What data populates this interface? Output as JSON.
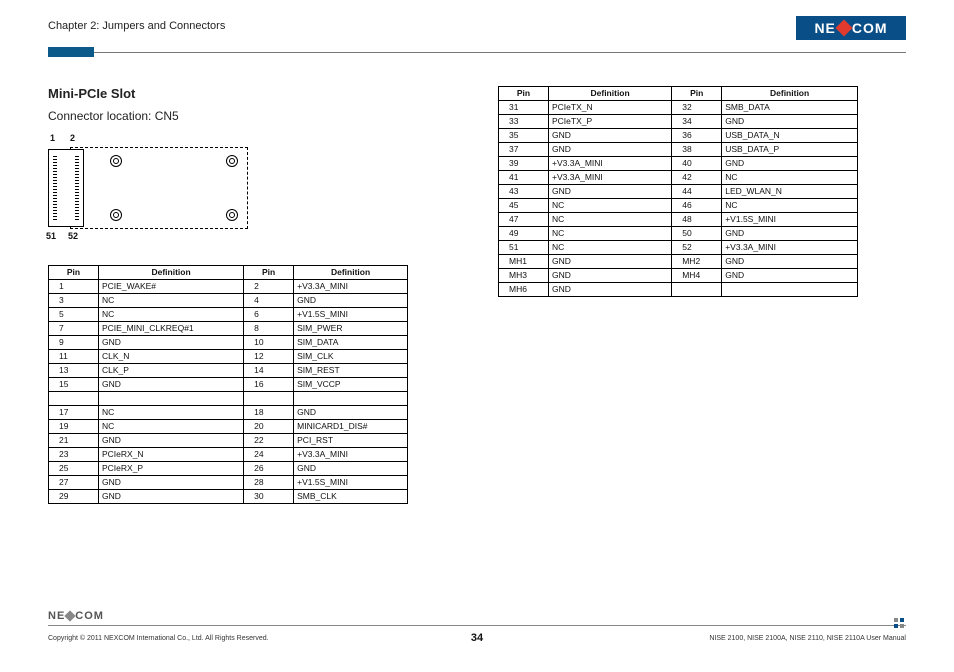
{
  "header": {
    "chapter": "Chapter 2: Jumpers and Connectors",
    "logo_pre": "NE",
    "logo_post": "COM"
  },
  "section": {
    "title": "Mini-PCIe Slot",
    "location": "Connector location: CN5",
    "diagram_labels": {
      "p1": "1",
      "p2": "2",
      "p51": "51",
      "p52": "52"
    }
  },
  "table_headers": {
    "pin": "Pin",
    "def": "Definition"
  },
  "left_rows_a": [
    {
      "p1": "1",
      "d1": "PCIE_WAKE#",
      "p2": "2",
      "d2": "+V3.3A_MINI"
    },
    {
      "p1": "3",
      "d1": "NC",
      "p2": "4",
      "d2": "GND"
    },
    {
      "p1": "5",
      "d1": "NC",
      "p2": "6",
      "d2": "+V1.5S_MINI"
    },
    {
      "p1": "7",
      "d1": "PCIE_MINI_CLKREQ#1",
      "p2": "8",
      "d2": "SIM_PWER"
    },
    {
      "p1": "9",
      "d1": "GND",
      "p2": "10",
      "d2": "SIM_DATA"
    },
    {
      "p1": "11",
      "d1": "CLK_N",
      "p2": "12",
      "d2": "SIM_CLK"
    },
    {
      "p1": "13",
      "d1": "CLK_P",
      "p2": "14",
      "d2": "SIM_REST"
    },
    {
      "p1": "15",
      "d1": "GND",
      "p2": "16",
      "d2": "SIM_VCCP"
    }
  ],
  "left_rows_b": [
    {
      "p1": "17",
      "d1": "NC",
      "p2": "18",
      "d2": "GND"
    },
    {
      "p1": "19",
      "d1": "NC",
      "p2": "20",
      "d2": "MINICARD1_DIS#"
    },
    {
      "p1": "21",
      "d1": "GND",
      "p2": "22",
      "d2": "PCI_RST"
    },
    {
      "p1": "23",
      "d1": "PCIeRX_N",
      "p2": "24",
      "d2": "+V3.3A_MINI"
    },
    {
      "p1": "25",
      "d1": "PCIeRX_P",
      "p2": "26",
      "d2": "GND"
    },
    {
      "p1": "27",
      "d1": "GND",
      "p2": "28",
      "d2": "+V1.5S_MINI"
    },
    {
      "p1": "29",
      "d1": "GND",
      "p2": "30",
      "d2": "SMB_CLK"
    }
  ],
  "right_rows": [
    {
      "p1": "31",
      "d1": "PCIeTX_N",
      "p2": "32",
      "d2": "SMB_DATA"
    },
    {
      "p1": "33",
      "d1": "PCIeTX_P",
      "p2": "34",
      "d2": "GND"
    },
    {
      "p1": "35",
      "d1": "GND",
      "p2": "36",
      "d2": "USB_DATA_N"
    },
    {
      "p1": "37",
      "d1": "GND",
      "p2": "38",
      "d2": "USB_DATA_P"
    },
    {
      "p1": "39",
      "d1": "+V3.3A_MINI",
      "p2": "40",
      "d2": "GND"
    },
    {
      "p1": "41",
      "d1": "+V3.3A_MINI",
      "p2": "42",
      "d2": "NC"
    },
    {
      "p1": "43",
      "d1": "GND",
      "p2": "44",
      "d2": "LED_WLAN_N"
    },
    {
      "p1": "45",
      "d1": "NC",
      "p2": "46",
      "d2": "NC"
    },
    {
      "p1": "47",
      "d1": "NC",
      "p2": "48",
      "d2": "+V1.5S_MINI"
    },
    {
      "p1": "49",
      "d1": "NC",
      "p2": "50",
      "d2": "GND"
    },
    {
      "p1": "51",
      "d1": "NC",
      "p2": "52",
      "d2": "+V3.3A_MINI"
    },
    {
      "p1": "MH1",
      "d1": "GND",
      "p2": "MH2",
      "d2": "GND"
    },
    {
      "p1": "MH3",
      "d1": "GND",
      "p2": "MH4",
      "d2": "GND"
    },
    {
      "p1": "MH6",
      "d1": "GND",
      "p2": "",
      "d2": ""
    }
  ],
  "footer": {
    "logo_pre": "NE",
    "logo_post": "COM",
    "copyright": "Copyright © 2011 NEXCOM International Co., Ltd. All Rights Reserved.",
    "page": "34",
    "manual": "NISE 2100, NISE 2100A, NISE 2110, NISE 2110A User Manual"
  }
}
